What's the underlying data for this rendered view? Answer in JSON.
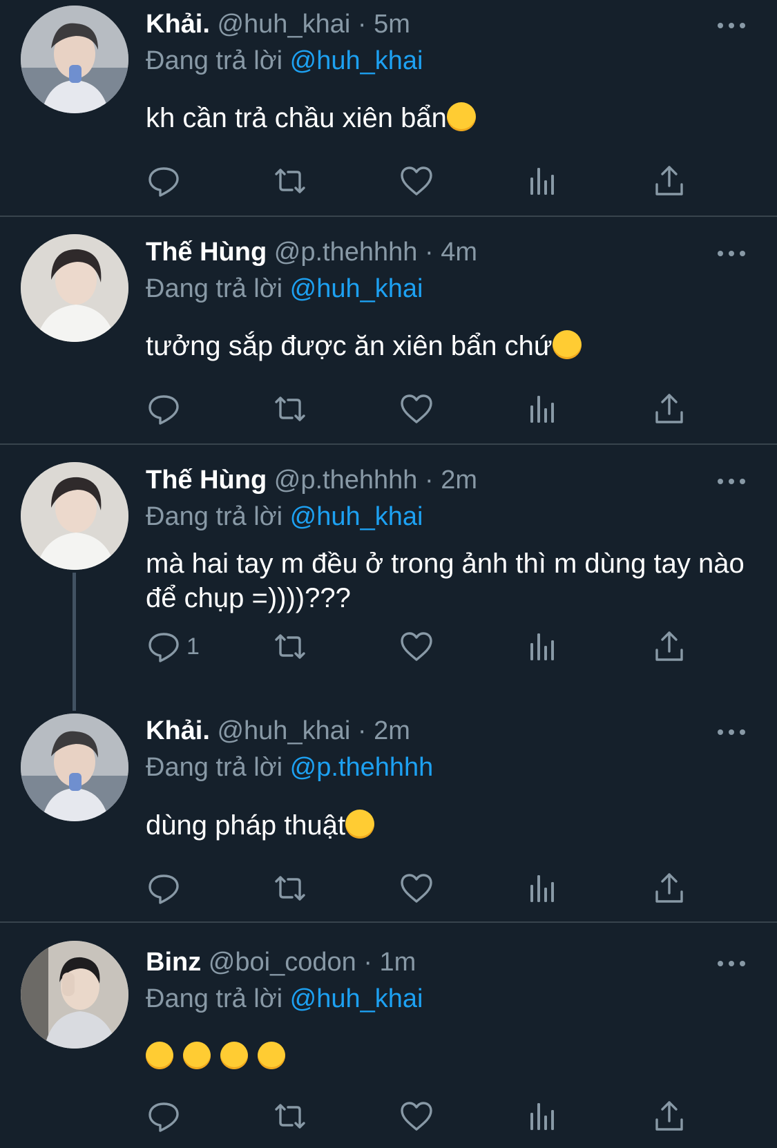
{
  "tweets": [
    {
      "name": "Khải.",
      "handle": "@huh_khai",
      "dot": "·",
      "time": "5m",
      "reply_prefix": "Đang trả lời",
      "reply_to": "@huh_khai",
      "text": "kh cần trả chầu xiên bẩn",
      "emoji": "star-struck-emoji",
      "reply_count": ""
    },
    {
      "name": "Thế Hùng",
      "handle": "@p.thehhhh",
      "dot": "·",
      "time": "4m",
      "reply_prefix": "Đang trả lời",
      "reply_to": "@huh_khai",
      "text": "tưởng sắp được ăn xiên bẩn chứ",
      "emoji": "disappointed-emoji",
      "reply_count": ""
    },
    {
      "name": "Thế Hùng",
      "handle": "@p.thehhhh",
      "dot": "·",
      "time": "2m",
      "reply_prefix": "Đang trả lời",
      "reply_to": "@huh_khai",
      "text": "mà hai tay m đều ở trong ảnh thì m dùng tay nào để chụp =))))???",
      "emoji": "",
      "reply_count": "1"
    },
    {
      "name": "Khải.",
      "handle": "@huh_khai",
      "dot": "·",
      "time": "2m",
      "reply_prefix": "Đang trả lời",
      "reply_to": "@p.thehhhh",
      "text": "dùng pháp thuật",
      "emoji": "grinning-emoji",
      "reply_count": ""
    },
    {
      "name": "Binz",
      "handle": "@boi_codon",
      "dot": "·",
      "time": "1m",
      "reply_prefix": "Đang trả lời",
      "reply_to": "@huh_khai",
      "text": "",
      "emoji": "hushed-face-emoji x4",
      "reply_count": ""
    }
  ],
  "colors": {
    "background": "#15202b",
    "divider": "#38444d",
    "secondary_text": "#8899a6",
    "accent": "#1da1f2"
  },
  "icons": [
    "reply-icon",
    "retweet-icon",
    "like-icon",
    "analytics-icon",
    "share-icon",
    "more-icon"
  ]
}
